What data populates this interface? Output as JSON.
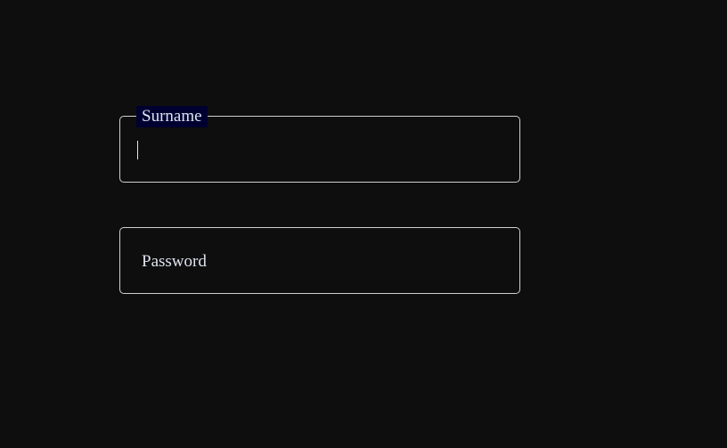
{
  "fields": {
    "surname": {
      "label": "Surname",
      "value": ""
    },
    "password": {
      "label": "Password",
      "value": ""
    }
  }
}
